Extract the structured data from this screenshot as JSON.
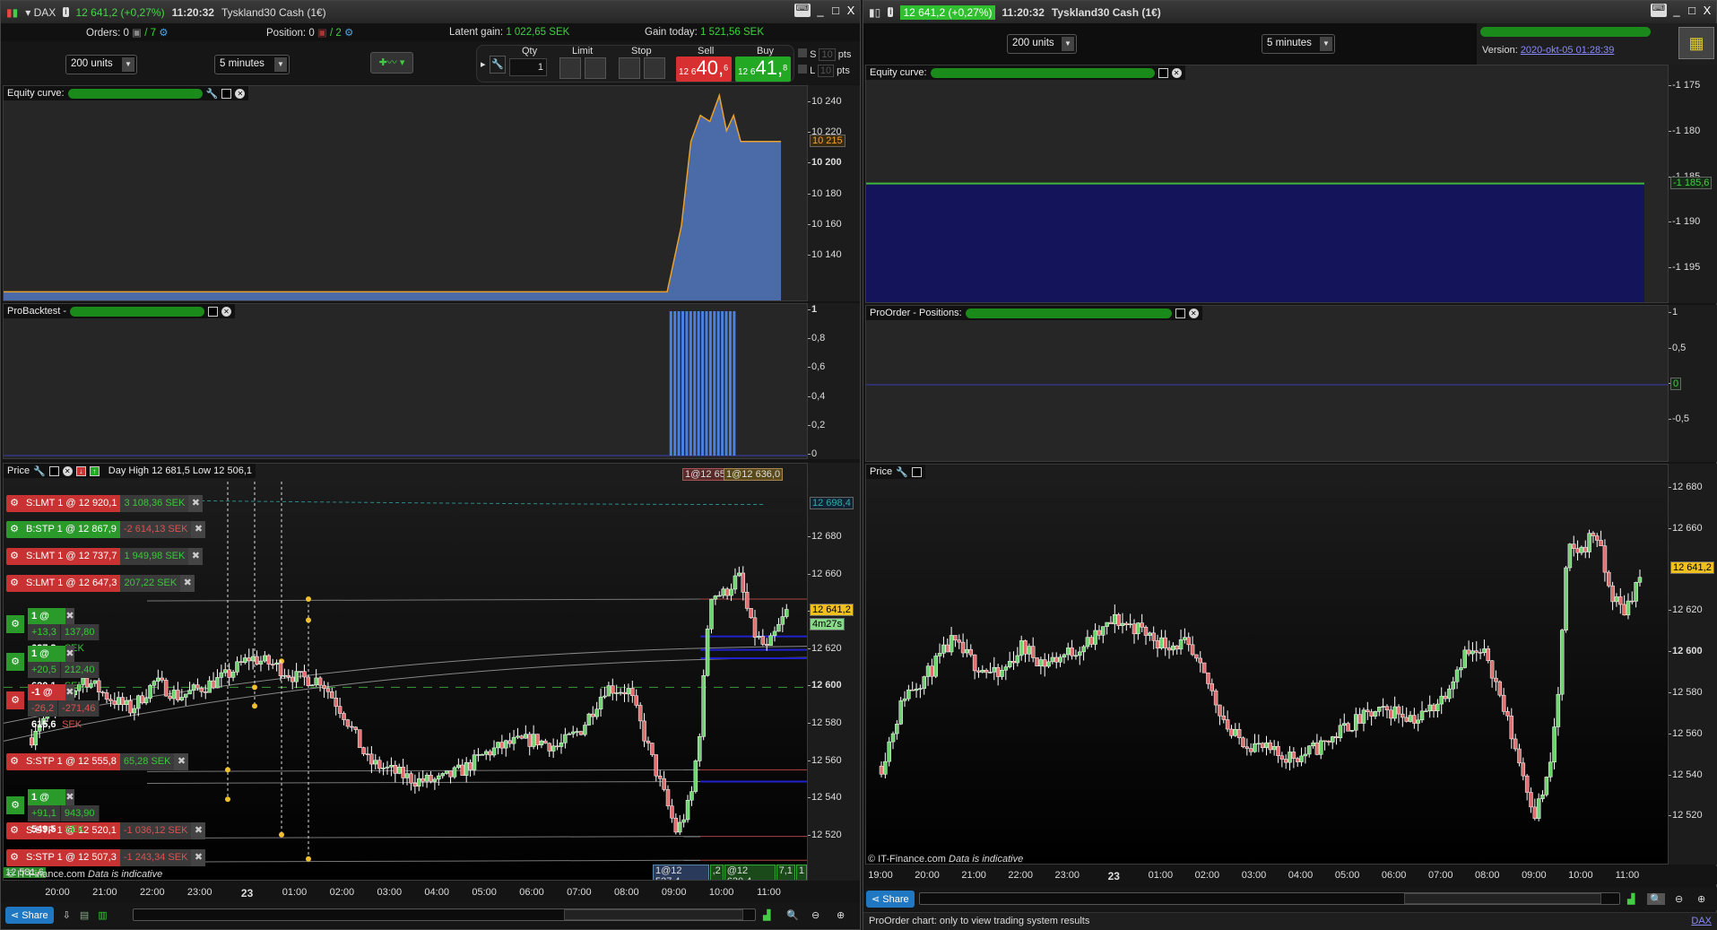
{
  "left": {
    "title": {
      "symbol": "DAX",
      "price": "12 641,2 (+0,27%)",
      "time": "11:20:32",
      "name": "Tyskland30 Cash (1€)"
    },
    "info": {
      "orders_label": "Orders:",
      "orders_count": "0",
      "orders_total": "/ 7",
      "position_label": "Position:",
      "position_count": "0",
      "position_total": "/ 2",
      "latent_label": "Latent gain:",
      "latent_value": "1 022,65 SEK",
      "gain_label": "Gain today:",
      "gain_value": "1 521,56 SEK"
    },
    "toolbar": {
      "units": "200 units",
      "timeframe": "5 minutes",
      "qty_label": "Qty",
      "qty_value": "1",
      "limit_label": "Limit",
      "stop_label": "Stop",
      "sell_label": "Sell",
      "buy_label": "Buy",
      "sell_prefix": "12 6",
      "sell_big": "40,",
      "sell_sup": "6",
      "buy_prefix": "12 6",
      "buy_big": "41,",
      "buy_sup": "8",
      "s_label": "S",
      "l_label": "L",
      "pts_value": "10",
      "pts_label": "pts"
    },
    "equity": {
      "label": "Equity curve:",
      "ticks": [
        "10 240",
        "10 220",
        "10 200",
        "10 180",
        "10 160",
        "10 140"
      ],
      "tick_values": [
        10240,
        10220,
        10200,
        10180,
        10160,
        10140
      ],
      "current": "10 215",
      "series": [
        [
          19.3,
          10117
        ],
        [
          8.8,
          10117
        ],
        [
          9.1,
          10160
        ],
        [
          9.3,
          10215
        ],
        [
          9.5,
          10232
        ],
        [
          9.7,
          10228
        ],
        [
          9.9,
          10245
        ],
        [
          10.05,
          10222
        ],
        [
          10.2,
          10232
        ],
        [
          10.35,
          10215
        ],
        [
          11.2,
          10215
        ]
      ],
      "color": "#e8a030",
      "fill": "#4a6aa8"
    },
    "probacktest": {
      "label": "ProBacktest -",
      "ticks": [
        "1",
        "0,8",
        "0,6",
        "0,4",
        "0,2",
        "0"
      ],
      "tick_values": [
        1,
        0.8,
        0.6,
        0.4,
        0.2,
        0
      ],
      "bars_from": 8.85,
      "bars_to": 10.2,
      "bar_value": 1
    },
    "price": {
      "label": "Price",
      "header_text": "Day High 12 681,5 Low 12 506,1",
      "top_tags": [
        "1@12 65",
        "1@12 636,0"
      ],
      "ticks": [
        "12 680",
        "12 660",
        "12 640",
        "12 620",
        "12 600",
        "12 580",
        "12 560",
        "12 540",
        "12 520"
      ],
      "tick_values": [
        12680,
        12660,
        12640,
        12620,
        12600,
        12580,
        12560,
        12540,
        12520
      ],
      "current": "12 641,2",
      "countdown": "4m27s",
      "ma_value": "12 698,4",
      "bottom_tags": [
        "1@12 537,4",
        ",2",
        "@12 630,4",
        "7,1",
        "1"
      ],
      "left_tag": "12 581,6",
      "orders": [
        {
          "kind": "S:LMT",
          "text": "S:LMT  1 @ 12 920,1",
          "pnl": "3 108,36 SEK",
          "pnl_pos": true,
          "side": "red"
        },
        {
          "kind": "B:STP",
          "text": "B:STP  1 @ 12 867,9",
          "pnl": "-2 614,13 SEK",
          "pnl_pos": false,
          "side": "green"
        },
        {
          "kind": "S:LMT",
          "text": "S:LMT  1 @ 12 737,7",
          "pnl": "1 949,98 SEK",
          "pnl_pos": true,
          "side": "red"
        },
        {
          "kind": "S:LMT",
          "text": "S:LMT  1 @ 12 647,3",
          "pnl": "207,22 SEK",
          "pnl_pos": true,
          "side": "red"
        },
        {
          "kind": "S:STP",
          "text": "S:STP  1 @ 12 555,8",
          "pnl": "65,28 SEK",
          "pnl_pos": true,
          "side": "red"
        },
        {
          "kind": "S:STP",
          "text": "S:STP  1 @ 12 520,1",
          "pnl": "-1 036,12 SEK",
          "pnl_pos": false,
          "side": "red"
        },
        {
          "kind": "S:STP",
          "text": "S:STP  1 @ 12 507,3",
          "pnl": "-1 243,34 SEK",
          "pnl_pos": false,
          "side": "red"
        }
      ],
      "positions": [
        {
          "text": "1 @ 12 627,3",
          "pts": "+13,3",
          "pnl": "137,80 SEK",
          "side": "green"
        },
        {
          "text": "1 @ 12 620,1",
          "pts": "+20,5",
          "pnl": "212,40 SEK",
          "side": "green"
        },
        {
          "text": "-1 @ 12 615,6",
          "pts": "-26,2",
          "pnl": "-271,46 SEK",
          "side": "red"
        },
        {
          "text": "1 @ 12 549,5",
          "pts": "+91,1",
          "pnl": "943,90 SEK",
          "side": "green"
        }
      ]
    },
    "copyright": "© IT-Finance.com",
    "indicative": "Data is indicative",
    "time_labels": [
      "20:00",
      "21:00",
      "22:00",
      "23:00",
      "23",
      "01:00",
      "02:00",
      "03:00",
      "04:00",
      "05:00",
      "06:00",
      "07:00",
      "08:00",
      "09:00",
      "10:00",
      "11:00"
    ],
    "share": "Share"
  },
  "right": {
    "title": {
      "price": "12 641,2 (+0,27%)",
      "time": "11:20:32",
      "name": "Tyskland30 Cash (1€)"
    },
    "toolbar": {
      "units": "200 units",
      "timeframe": "5 minutes",
      "version_label": "Version:",
      "version_value": "2020-okt-05 01:28:39"
    },
    "equity": {
      "label": "Equity curve:",
      "ticks": [
        "-1 175",
        "-1 180",
        "-1 185",
        "-1 190",
        "-1 195"
      ],
      "tick_values": [
        -1175,
        -1180,
        -1185,
        -1190,
        -1195
      ],
      "current": "-1 185,6",
      "value": -1185.6,
      "line_color": "#3cb83c",
      "fill": "#14145a"
    },
    "positions": {
      "label": "ProOrder - Positions:",
      "ticks": [
        "1",
        "0,5",
        "0",
        "-0,5"
      ],
      "tick_values": [
        1,
        0.5,
        0,
        -0.5
      ],
      "current": "0"
    },
    "price": {
      "label": "Price",
      "ticks": [
        "12 680",
        "12 660",
        "12 620",
        "12 600",
        "12 580",
        "12 560",
        "12 540",
        "12 520"
      ],
      "tick_values": [
        12680,
        12660,
        12620,
        12600,
        12580,
        12560,
        12540,
        12520
      ],
      "current": "12 641,2"
    },
    "copyright": "© IT-Finance.com",
    "indicative": "Data is indicative",
    "time_labels": [
      "19:00",
      "20:00",
      "21:00",
      "22:00",
      "23:00",
      "23",
      "01:00",
      "02:00",
      "03:00",
      "04:00",
      "05:00",
      "06:00",
      "07:00",
      "08:00",
      "09:00",
      "10:00",
      "11:00"
    ],
    "share": "Share",
    "status": "ProOrder chart: only to view trading system results",
    "status_link": "DAX"
  },
  "price_path": [
    [
      19.0,
      12545
    ],
    [
      19.5,
      12580
    ],
    [
      20.0,
      12590
    ],
    [
      20.5,
      12605
    ],
    [
      21.0,
      12595
    ],
    [
      21.5,
      12588
    ],
    [
      22.0,
      12603
    ],
    [
      22.5,
      12595
    ],
    [
      23.0,
      12600
    ],
    [
      23.5,
      12606
    ],
    [
      24.0,
      12616
    ],
    [
      24.5,
      12612
    ],
    [
      25.0,
      12605
    ],
    [
      25.5,
      12604
    ],
    [
      26.0,
      12585
    ],
    [
      26.5,
      12560
    ],
    [
      27.0,
      12555
    ],
    [
      27.5,
      12550
    ],
    [
      28.0,
      12550
    ],
    [
      28.5,
      12556
    ],
    [
      29.0,
      12565
    ],
    [
      29.5,
      12570
    ],
    [
      30.0,
      12572
    ],
    [
      30.5,
      12568
    ],
    [
      31.0,
      12578
    ],
    [
      31.5,
      12600
    ],
    [
      32.0,
      12598
    ],
    [
      32.5,
      12560
    ],
    [
      33.0,
      12522
    ],
    [
      33.3,
      12540
    ],
    [
      33.5,
      12580
    ],
    [
      33.7,
      12650
    ],
    [
      34.0,
      12650
    ],
    [
      34.3,
      12660
    ],
    [
      34.6,
      12630
    ],
    [
      34.9,
      12620
    ],
    [
      35.33,
      12641
    ]
  ]
}
